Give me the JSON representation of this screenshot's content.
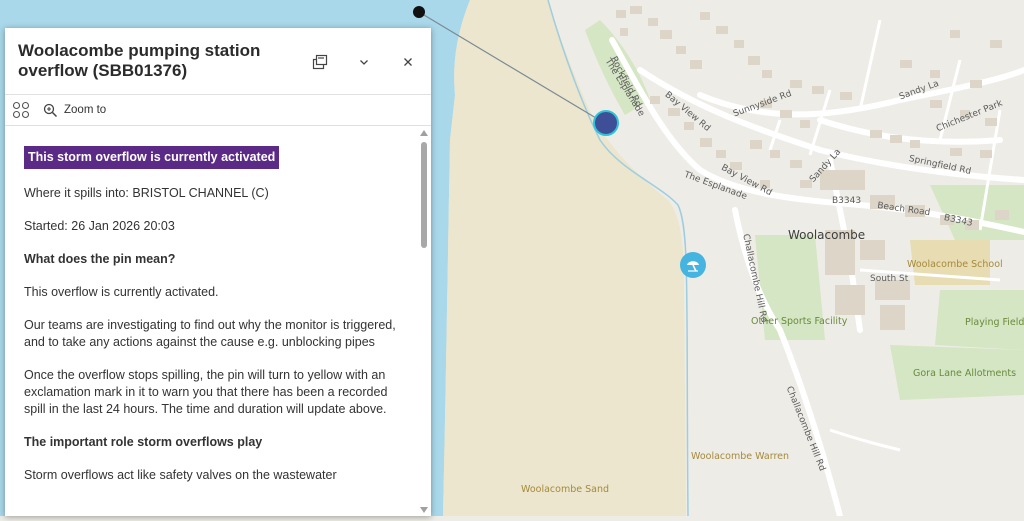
{
  "colors": {
    "water": "#a9d8ea",
    "sand": "#ebe6cd",
    "land": "#eeece6",
    "park": "#d4e6c3",
    "building": "#ddd6c8",
    "road": "#ffffff",
    "pin": "#3f4f97",
    "pin_ring": "#2ec4d8",
    "beach_icon": "#46b4e0",
    "badge": "#5b2a86"
  },
  "panel": {
    "title": "Woolacombe pumping station overflow (SBB01376)",
    "dock_icon": "dock-icon",
    "collapse_icon": "chevron-down-icon",
    "close_icon": "close-icon",
    "tools": {
      "group_icon": "select-features-icon",
      "zoom_icon": "zoom-to-icon",
      "zoom_label": "Zoom to"
    },
    "status_badge": "This storm overflow is currently activated",
    "spills_into": "Where it spills into: BRISTOL CHANNEL (C)",
    "started": "Started: 26 Jan 2026 20:03",
    "heading_pin": "What does the pin mean?",
    "para_activated": "This overflow is currently activated.",
    "para_investigating": "Our teams are investigating to find out why the monitor is triggered, and to take any actions against the cause e.g. unblocking pipes",
    "para_once": "Once the overflow stops spilling, the pin will turn to yellow with an exclamation mark in it to warn you that there has been a recorded spill in the last 24 hours. The time and duration will update above.",
    "heading_role": "The important role storm overflows play",
    "para_role": "Storm overflows act like safety valves on the wastewater"
  },
  "map": {
    "labels": {
      "rockfield": "Rockfield Rd",
      "esplanade1": "The Esplanade",
      "bayview1": "Bay View Rd",
      "sunnyside": "Sunnyside Rd",
      "sandy1": "Sandy La",
      "chichester": "Chichester Park",
      "springfield": "Springfield Rd",
      "sandy2": "Sandy La",
      "bayview2": "Bay View Rd",
      "esplanade2": "The Esplanade",
      "b3343a": "B3343",
      "beach_road": "Beach Road",
      "b3343b": "B3343",
      "woolacombe": "Woolacombe",
      "challacombe1": "Challacombe Hill Rd",
      "school": "Woolacombe School",
      "south_st": "South St",
      "other_sports": "Other Sports Facility",
      "playing_field": "Playing Field",
      "gora": "Gora Lane Allotments",
      "challacombe2": "Challacombe Hill Rd",
      "warren": "Woolacombe Warren",
      "sand": "Woolacombe Sand"
    },
    "pin_icon": "overflow-pin-icon",
    "beach_icon": "beach-umbrella-icon"
  }
}
